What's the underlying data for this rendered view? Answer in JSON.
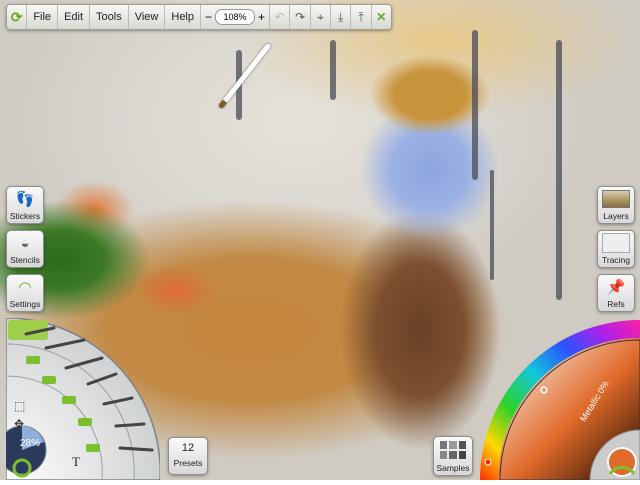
{
  "toolbar": {
    "menus": [
      "File",
      "Edit",
      "Tools",
      "View",
      "Help"
    ],
    "zoom_minus": "−",
    "zoom_value": "108%",
    "zoom_plus": "+",
    "icons": [
      "undo-icon",
      "redo-icon",
      "canvas-size-icon",
      "import-icon",
      "export-icon",
      "full-screen-icon"
    ]
  },
  "left_panel": {
    "stickers_label": "Stickers",
    "stencils_label": "Stencils",
    "settings_label": "Settings"
  },
  "right_panel": {
    "layers_label": "Layers",
    "tracing_label": "Tracing",
    "refs_label": "Refs"
  },
  "tool_wheel": {
    "brush_size": "28%",
    "text_tool": "T"
  },
  "presets": {
    "count": "12",
    "label": "Presets"
  },
  "samples": {
    "label": "Samples"
  },
  "color_picker": {
    "metallic_label": "Metallic 0%",
    "current_color": "#e06a2a",
    "accent": "#7bbf2e"
  }
}
